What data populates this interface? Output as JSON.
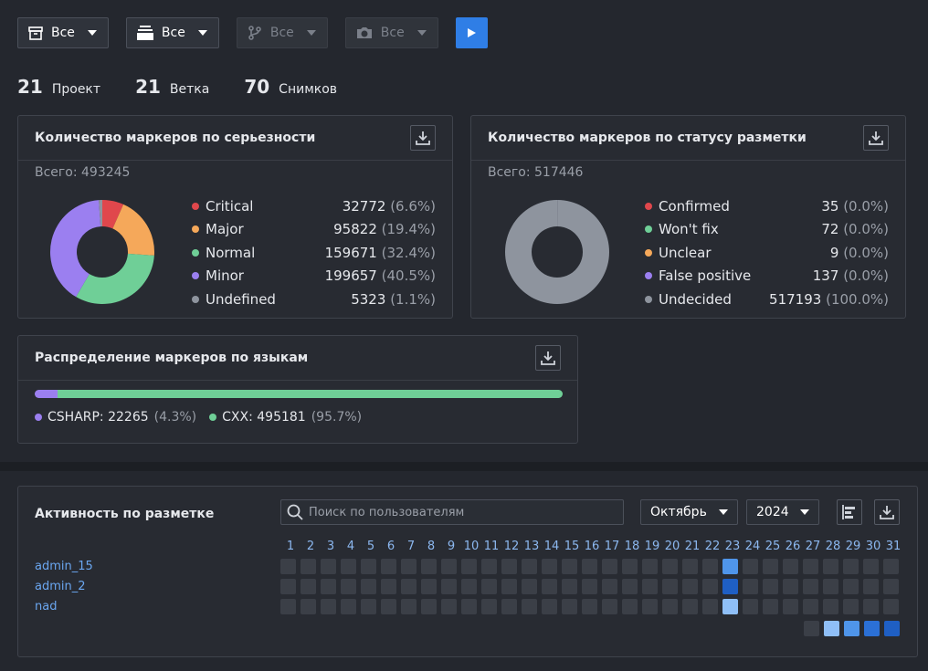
{
  "filters": [
    {
      "name": "project-filter",
      "icon": "archive-icon",
      "label": "Все",
      "disabled": false
    },
    {
      "name": "branch-filter",
      "icon": "inbox-stack-icon",
      "label": "Все",
      "disabled": false
    },
    {
      "name": "git-branch-filter",
      "icon": "git-branch-icon",
      "label": "Все",
      "disabled": true
    },
    {
      "name": "snapshot-filter",
      "icon": "camera-icon",
      "label": "Все",
      "disabled": true
    }
  ],
  "stats": [
    {
      "value": "21",
      "label": "Проект"
    },
    {
      "value": "21",
      "label": "Ветка"
    },
    {
      "value": "70",
      "label": "Снимков"
    }
  ],
  "severity_card": {
    "title": "Количество маркеров по серьезности",
    "total": "Всего: 493245",
    "items": [
      {
        "label": "Critical",
        "value": "32772",
        "pct": "(6.6%)",
        "n": 32772,
        "color": "#e0474c"
      },
      {
        "label": "Major",
        "value": "95822",
        "pct": "(19.4%)",
        "n": 95822,
        "color": "#f5a85a"
      },
      {
        "label": "Normal",
        "value": "159671",
        "pct": "(32.4%)",
        "n": 159671,
        "color": "#6fcf97"
      },
      {
        "label": "Minor",
        "value": "199657",
        "pct": "(40.5%)",
        "n": 199657,
        "color": "#9b7ff0"
      },
      {
        "label": "Undefined",
        "value": "5323",
        "pct": "(1.1%)",
        "n": 5323,
        "color": "#8e949e"
      }
    ]
  },
  "status_card": {
    "title": "Количество маркеров по статусу разметки",
    "total": "Всего: 517446",
    "items": [
      {
        "label": "Confirmed",
        "value": "35",
        "pct": "(0.0%)",
        "n": 35,
        "color": "#e0474c"
      },
      {
        "label": "Won't fix",
        "value": "72",
        "pct": "(0.0%)",
        "n": 72,
        "color": "#6fcf97"
      },
      {
        "label": "Unclear",
        "value": "9",
        "pct": "(0.0%)",
        "n": 9,
        "color": "#f5a85a"
      },
      {
        "label": "False positive",
        "value": "137",
        "pct": "(0.0%)",
        "n": 137,
        "color": "#9b7ff0"
      },
      {
        "label": "Undecided",
        "value": "517193",
        "pct": "(100.0%)",
        "n": 517193,
        "color": "#8e949e"
      }
    ]
  },
  "lang_card": {
    "title": "Распределение маркеров по языкам",
    "items": [
      {
        "label": "CSHARP: 22265",
        "pct": "(4.3%)",
        "frac": 0.043,
        "color": "#9b7ff0"
      },
      {
        "label": "CXX: 495181",
        "pct": "(95.7%)",
        "frac": 0.957,
        "color": "#6fcf97"
      }
    ]
  },
  "activity": {
    "title": "Активность по разметке",
    "search_placeholder": "Поиск по пользователям",
    "month": "Октябрь",
    "year": "2024",
    "days": [
      "1",
      "2",
      "3",
      "4",
      "5",
      "6",
      "7",
      "8",
      "9",
      "10",
      "11",
      "12",
      "13",
      "14",
      "15",
      "16",
      "17",
      "18",
      "19",
      "20",
      "21",
      "22",
      "23",
      "24",
      "25",
      "26",
      "27",
      "28",
      "29",
      "30",
      "31"
    ],
    "users": [
      {
        "name": "admin_15",
        "active": {
          "23": 2
        }
      },
      {
        "name": "admin_2",
        "active": {
          "23": 4
        }
      },
      {
        "name": "nad",
        "active": {
          "23": 1
        }
      }
    ],
    "level_colors": [
      "#3b3f47",
      "#8fbff7",
      "#4f95ea",
      "#2b70d6",
      "#1f5fc4"
    ]
  }
}
